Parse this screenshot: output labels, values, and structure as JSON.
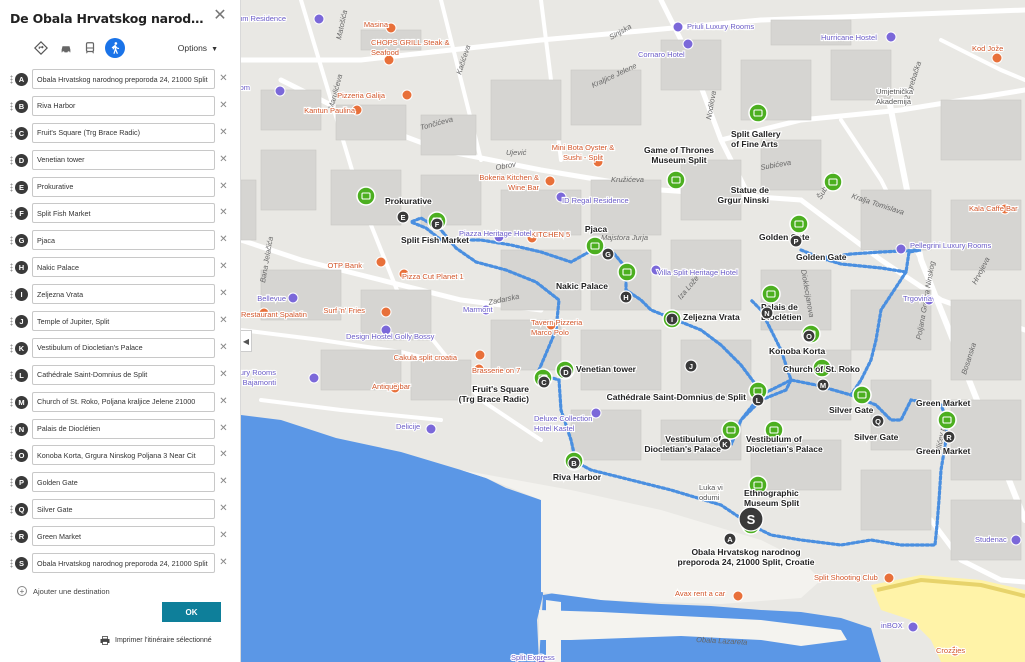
{
  "panel": {
    "title": "De Obala Hrvatskog narodnog prep...",
    "options_label": "Options",
    "stops": [
      {
        "letter": "A",
        "value": "Obala Hrvatskog narodnog preporoda 24, 21000 Split"
      },
      {
        "letter": "B",
        "value": "Riva Harbor"
      },
      {
        "letter": "C",
        "value": "Fruit's Square (Trg Brace Radic)"
      },
      {
        "letter": "D",
        "value": "Venetian tower"
      },
      {
        "letter": "E",
        "value": "Prokurative"
      },
      {
        "letter": "F",
        "value": "Split Fish Market"
      },
      {
        "letter": "G",
        "value": "Pjaca"
      },
      {
        "letter": "H",
        "value": "Nakic Palace"
      },
      {
        "letter": "I",
        "value": "Zeljezna Vrata"
      },
      {
        "letter": "J",
        "value": "Temple of Jupiter, Split"
      },
      {
        "letter": "K",
        "value": "Vestibulum of Diocletian's Palace"
      },
      {
        "letter": "L",
        "value": "Cathédrale Saint-Domnius de Split"
      },
      {
        "letter": "M",
        "value": "Church of St. Roko, Poljana kraljice Jelene 21000"
      },
      {
        "letter": "N",
        "value": "Palais de Dioclétien"
      },
      {
        "letter": "O",
        "value": "Konoba Korta, Grgura Ninskog Poljana 3 Near Cit"
      },
      {
        "letter": "P",
        "value": "Golden Gate"
      },
      {
        "letter": "Q",
        "value": "Silver Gate"
      },
      {
        "letter": "R",
        "value": "Green Market"
      },
      {
        "letter": "S",
        "value": "Obala Hrvatskog narodnog preporoda 24, 21000 Split"
      }
    ],
    "add_destination": "Ajouter une destination",
    "ok_label": "OK",
    "print_label": "Imprimer l'itinéraire sélectionné"
  },
  "map": {
    "colors": {
      "route": "#4a8fe0",
      "poi_green": "#4caf20",
      "water": "#5b97e6",
      "restaurant": "#e8703a",
      "hotel": "#7b68d9"
    },
    "street_labels": [
      {
        "text": "Obala Lazareta"
      },
      {
        "text": "Zadarska"
      },
      {
        "text": "Kraljice Jelene"
      },
      {
        "text": "Zagrebačka"
      },
      {
        "text": "Kralja Tomislava"
      },
      {
        "text": "Hrvojeva"
      },
      {
        "text": "Bana Jelačića"
      },
      {
        "text": "Matošića"
      },
      {
        "text": "Marulićeva"
      },
      {
        "text": "Sinjska"
      },
      {
        "text": "Nodilova"
      },
      {
        "text": "Šubićeva"
      },
      {
        "text": "Obrov"
      },
      {
        "text": "Dioklecijanova"
      },
      {
        "text": "Poljana Grgura Ninskog"
      },
      {
        "text": "Ilićev prolaz"
      },
      {
        "text": "Bosanska"
      },
      {
        "text": "Ujević"
      },
      {
        "text": "Subićeva"
      },
      {
        "text": "Kružićeva"
      },
      {
        "text": "Iza Lože"
      },
      {
        "text": "Tončićeva"
      },
      {
        "text": "Kačićeva"
      },
      {
        "text": "Majstora Jurja"
      }
    ],
    "place_labels": [
      {
        "text": "Prokurative",
        "kind": "poi"
      },
      {
        "text": "Split Fish Market",
        "kind": "poi"
      },
      {
        "text": "Pjaca",
        "kind": "poi"
      },
      {
        "text": "Nakic Palace",
        "kind": "poi"
      },
      {
        "text": "Zeljezna Vrata",
        "kind": "poi"
      },
      {
        "text": "Venetian tower",
        "kind": "poi"
      },
      {
        "text": "Fruit's Square\n(Trg Brace Radic)",
        "kind": "poi"
      },
      {
        "text": "Cathédrale Saint-Domnius de Split",
        "kind": "poi"
      },
      {
        "text": "Vestibulum of\nDiocletian's Palace",
        "kind": "poi"
      },
      {
        "text": "Vestibulum of\nDiocletian's Palace",
        "kind": "poi"
      },
      {
        "text": "Riva Harbor",
        "kind": "poi"
      },
      {
        "text": "Golden Gate",
        "kind": "poi"
      },
      {
        "text": "Golden Gate",
        "kind": "poi"
      },
      {
        "text": "Palais de\nDioclétien",
        "kind": "poi"
      },
      {
        "text": "Konoba Korta",
        "kind": "poi"
      },
      {
        "text": "Church of St. Roko",
        "kind": "poi"
      },
      {
        "text": "Silver Gate",
        "kind": "poi"
      },
      {
        "text": "Silver Gate",
        "kind": "poi"
      },
      {
        "text": "Green Market",
        "kind": "poi"
      },
      {
        "text": "Green Market",
        "kind": "poi"
      },
      {
        "text": "Statue de\nGrgur Ninski",
        "kind": "poi"
      },
      {
        "text": "Game of Thrones\nMuseum Split",
        "kind": "poi"
      },
      {
        "text": "Split Gallery\nof Fine Arts",
        "kind": "poi"
      },
      {
        "text": "Ethnographic\nMuseum Split",
        "kind": "poi"
      },
      {
        "text": "Obala Hrvatskog narodnog\npreporoda 24, 21000 Split, Croatie",
        "kind": "poi"
      },
      {
        "text": "Mini Bota Oyster &\nSushi - Split",
        "kind": "restaurant"
      },
      {
        "text": "Bokeria Kitchen &\nWine Bar",
        "kind": "restaurant"
      },
      {
        "text": "KITCHEN 5",
        "kind": "restaurant"
      },
      {
        "text": "CHOPS GRILL Steak &\nSeafood",
        "kind": "restaurant"
      },
      {
        "text": "Masina",
        "kind": "restaurant"
      },
      {
        "text": "Pizzeria Galija",
        "kind": "restaurant"
      },
      {
        "text": "Kantun Paulina",
        "kind": "restaurant"
      },
      {
        "text": "OTP Bank",
        "kind": "restaurant"
      },
      {
        "text": "Pizza Cut Planet 1",
        "kind": "restaurant"
      },
      {
        "text": "Surf 'n' Fries",
        "kind": "restaurant"
      },
      {
        "text": "Tavern Pizzeria\nMarco Polo",
        "kind": "restaurant"
      },
      {
        "text": "Cakula split croatia",
        "kind": "restaurant"
      },
      {
        "text": "Brasserie on 7",
        "kind": "restaurant"
      },
      {
        "text": "Antique bar",
        "kind": "restaurant"
      },
      {
        "text": "Restaurant Spalatin",
        "kind": "restaurant"
      },
      {
        "text": "Avax rent a car",
        "kind": "restaurant"
      },
      {
        "text": "Kod Jože",
        "kind": "restaurant"
      },
      {
        "text": "Kala Caffe Bar",
        "kind": "restaurant"
      },
      {
        "text": "Split Shooting Club",
        "kind": "restaurant"
      },
      {
        "text": "Crozzies",
        "kind": "restaurant"
      },
      {
        "text": "Palatium Residence",
        "kind": "hotel"
      },
      {
        "text": "Priuli Luxury Rooms",
        "kind": "hotel"
      },
      {
        "text": "Cornaro Hotel",
        "kind": "hotel"
      },
      {
        "text": "Hurricane Hostel",
        "kind": "hotel"
      },
      {
        "text": "Studio & Room",
        "kind": "hotel"
      },
      {
        "text": "ID Regal Residence",
        "kind": "hotel"
      },
      {
        "text": "Piazza Heritage Hotel",
        "kind": "hotel"
      },
      {
        "text": "Villa Split Heritage Hotel",
        "kind": "hotel"
      },
      {
        "text": "Pellegrini Luxury Rooms",
        "kind": "hotel"
      },
      {
        "text": "Trgovina",
        "kind": "hotel"
      },
      {
        "text": "Marmont",
        "kind": "hotel"
      },
      {
        "text": "Design Hostel Golly Bossy",
        "kind": "hotel"
      },
      {
        "text": "Bellevue",
        "kind": "hotel"
      },
      {
        "text": "Luxury Rooms\nBajamonti",
        "kind": "hotel"
      },
      {
        "text": "Deluxe Collection\nHotel Kastel",
        "kind": "hotel"
      },
      {
        "text": "Delicije",
        "kind": "hotel"
      },
      {
        "text": "Studenac",
        "kind": "hotel"
      },
      {
        "text": "inBOX",
        "kind": "hotel"
      },
      {
        "text": "Split Express",
        "kind": "hotel"
      },
      {
        "text": "Umjetnička\nAkademija",
        "kind": "other"
      },
      {
        "text": "Luka vi\nodumi",
        "kind": "other"
      }
    ],
    "route_markers": [
      {
        "letter": "S"
      },
      {
        "letter": "A"
      },
      {
        "letter": "B"
      },
      {
        "letter": "C"
      },
      {
        "letter": "D"
      },
      {
        "letter": "E"
      },
      {
        "letter": "F"
      },
      {
        "letter": "G"
      },
      {
        "letter": "H"
      },
      {
        "letter": "I"
      },
      {
        "letter": "J"
      },
      {
        "letter": "K"
      },
      {
        "letter": "L"
      },
      {
        "letter": "M"
      },
      {
        "letter": "N"
      },
      {
        "letter": "O"
      },
      {
        "letter": "P"
      },
      {
        "letter": "Q"
      },
      {
        "letter": "R"
      }
    ]
  }
}
